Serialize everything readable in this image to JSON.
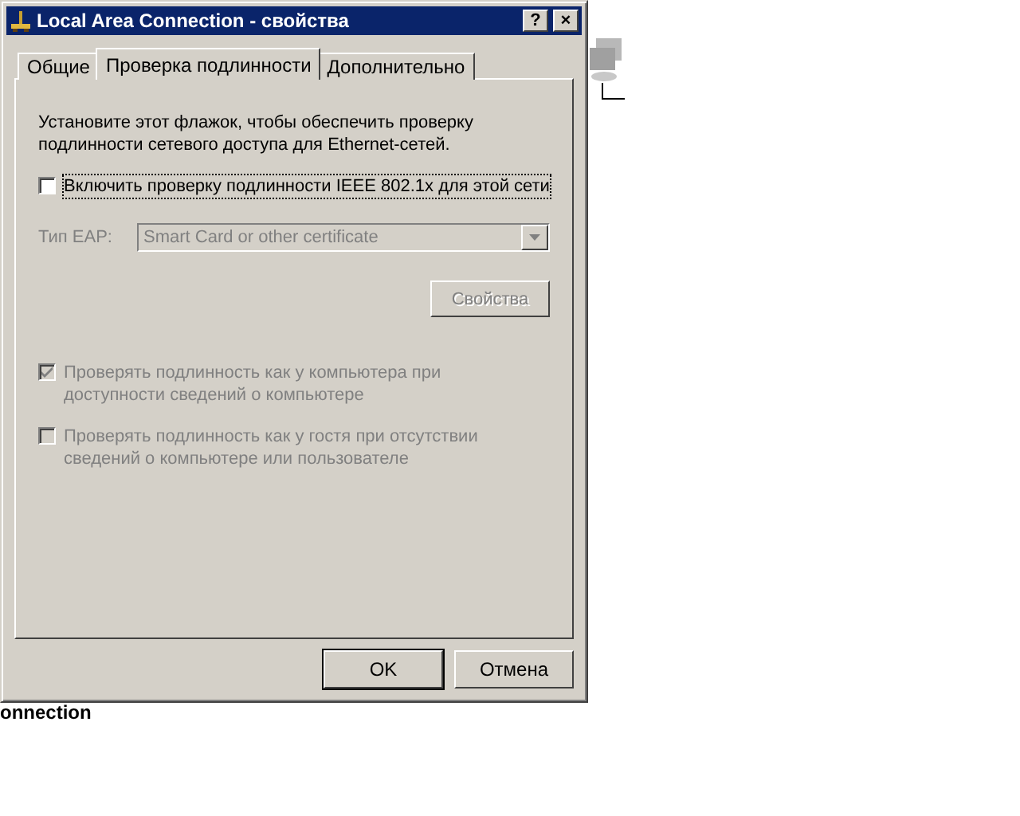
{
  "window": {
    "title": "Local Area Connection - свойства",
    "help_button": "?",
    "close_button": "×"
  },
  "tabs": [
    {
      "label": "Общие",
      "selected": false
    },
    {
      "label": "Проверка подлинности",
      "selected": true
    },
    {
      "label": "Дополнительно",
      "selected": false
    }
  ],
  "intro": "Установите этот флажок, чтобы обеспечить проверку подлинности сетевого доступа для Ethernet-сетей.",
  "enable": {
    "label": "Включить проверку подлинности IEEE 802.1x для этой сети",
    "checked": false,
    "disabled": false,
    "focused": true
  },
  "eap": {
    "label": "Тип EAP:",
    "value": "Smart Card or other certificate",
    "disabled": true
  },
  "properties_button": {
    "label": "Свойства",
    "disabled": true
  },
  "options": [
    {
      "label": "Проверять подлинность как у компьютера при доступности сведений о компьютере",
      "checked": true,
      "disabled": true
    },
    {
      "label": "Проверять подлинность как у гостя при отсутствии сведений о компьютере или пользователе",
      "checked": false,
      "disabled": true
    }
  ],
  "buttons": [
    {
      "label": "OK",
      "default": true
    },
    {
      "label": "Отмена",
      "default": false
    }
  ],
  "desktop": {
    "label": "onnection"
  }
}
